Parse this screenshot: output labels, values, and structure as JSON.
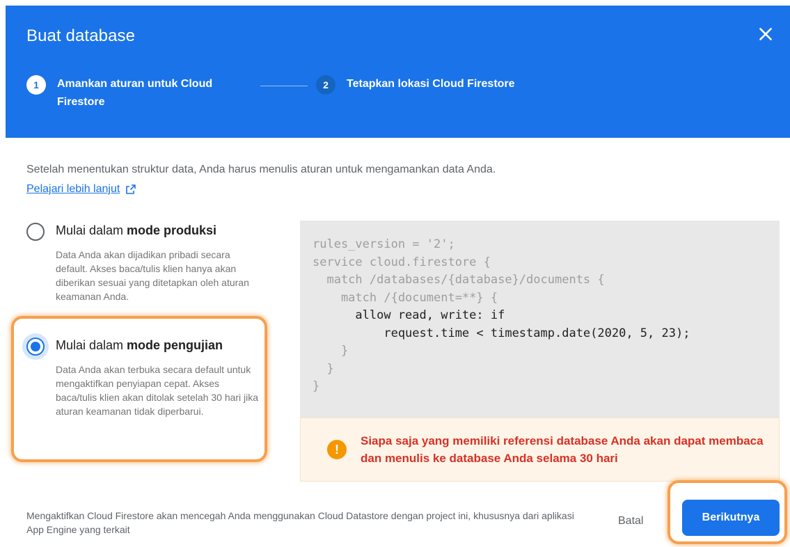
{
  "dialog": {
    "title": "Buat database",
    "close_icon": "close-icon"
  },
  "stepper": {
    "steps": [
      {
        "number": "1",
        "label": "Amankan aturan untuk Cloud Firestore",
        "active": true
      },
      {
        "number": "2",
        "label": "Tetapkan lokasi Cloud Firestore",
        "active": false
      }
    ]
  },
  "intro": {
    "text": "Setelah menentukan struktur data, Anda harus menulis aturan untuk mengamankan data Anda.",
    "link_label": "Pelajari lebih lanjut",
    "link_icon": "external-link-icon"
  },
  "options": {
    "production": {
      "title_prefix": "Mulai dalam ",
      "title_bold": "mode produksi",
      "description": "Data Anda akan dijadikan pribadi secara default. Akses baca/tulis klien hanya akan diberikan sesuai yang ditetapkan oleh aturan keamanan Anda.",
      "selected": false
    },
    "test": {
      "title_prefix": "Mulai dalam ",
      "title_bold": "mode pengujian",
      "description": "Data Anda akan terbuka secara default untuk mengaktifkan penyiapan cepat. Akses baca/tulis klien akan ditolak setelah 30 hari jika aturan keamanan tidak diperbarui.",
      "selected": true
    }
  },
  "rules_code": {
    "lines": [
      "rules_version = '2';",
      "service cloud.firestore {",
      "  match /databases/{database}/documents {",
      "    match /{document=**} {",
      "      allow read, write: if",
      "          request.time < timestamp.date(2020, 5, 23);",
      "    }",
      "  }",
      "}"
    ]
  },
  "warning": {
    "icon": "warning-icon",
    "text": "Siapa saja yang memiliki referensi database Anda akan dapat membaca dan menulis ke database Anda selama 30 hari"
  },
  "footer": {
    "note": "Mengaktifkan Cloud Firestore akan mencegah Anda menggunakan Cloud Datastore dengan project ini, khususnya dari aplikasi App Engine yang terkait",
    "cancel_label": "Batal",
    "next_label": "Berikutnya"
  },
  "colors": {
    "header": "#1a73e8",
    "primary": "#1a73e8",
    "warning_text": "#d93025",
    "warning_icon": "#f59700",
    "highlight": "#f6a04d"
  }
}
